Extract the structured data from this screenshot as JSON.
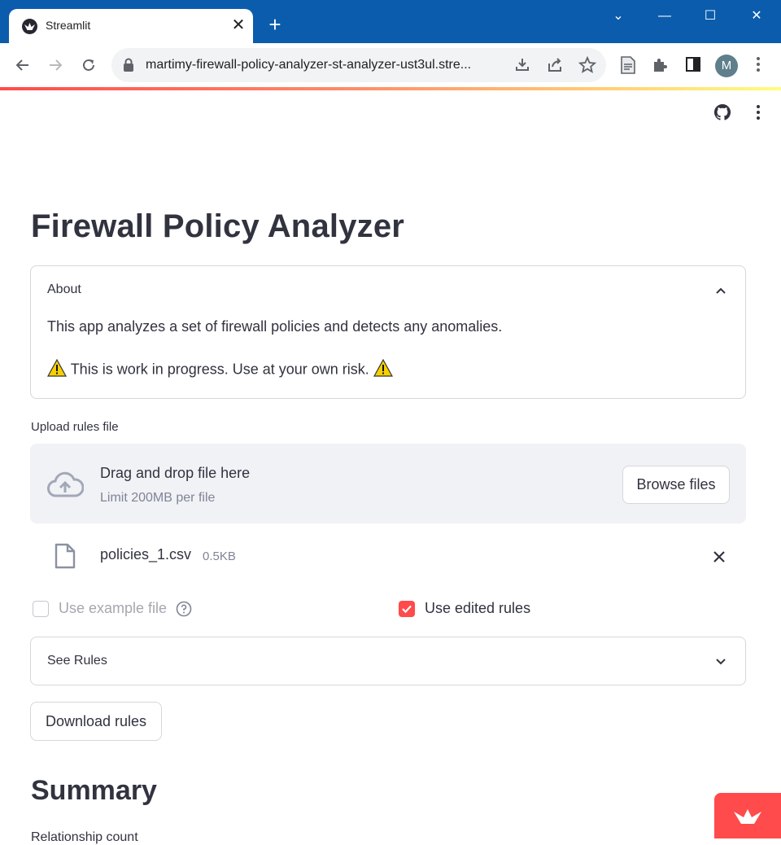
{
  "browser": {
    "tab_title": "Streamlit",
    "tab_close": "✕",
    "new_tab": "+",
    "url": "martimy-firewall-policy-analyzer-st-analyzer-ust3ul.stre...",
    "profile_initial": "M",
    "window_controls": [
      "⌄",
      "—",
      "☐",
      "✕"
    ]
  },
  "app": {
    "title": "Firewall Policy Analyzer",
    "about": {
      "header": "About",
      "description": "This app analyzes a set of firewall policies and detects any anomalies.",
      "warning": "This is work in progress. Use at your own risk."
    },
    "uploader": {
      "label": "Upload rules file",
      "drag_text": "Drag and drop file here",
      "limit_text": "Limit 200MB per file",
      "browse_label": "Browse files",
      "file": {
        "name": "policies_1.csv",
        "size": "0.5KB"
      }
    },
    "use_example": {
      "label": "Use example file",
      "checked": false,
      "disabled": true
    },
    "use_edited": {
      "label": "Use edited rules",
      "checked": true
    },
    "see_rules": {
      "header": "See Rules"
    },
    "download_label": "Download rules",
    "summary_title": "Summary",
    "summary_subtext": "Relationship count"
  },
  "colors": {
    "accent": "#ff4b4b",
    "chrome_blue": "#0b5cad",
    "text": "#31333f",
    "muted": "#808495"
  }
}
